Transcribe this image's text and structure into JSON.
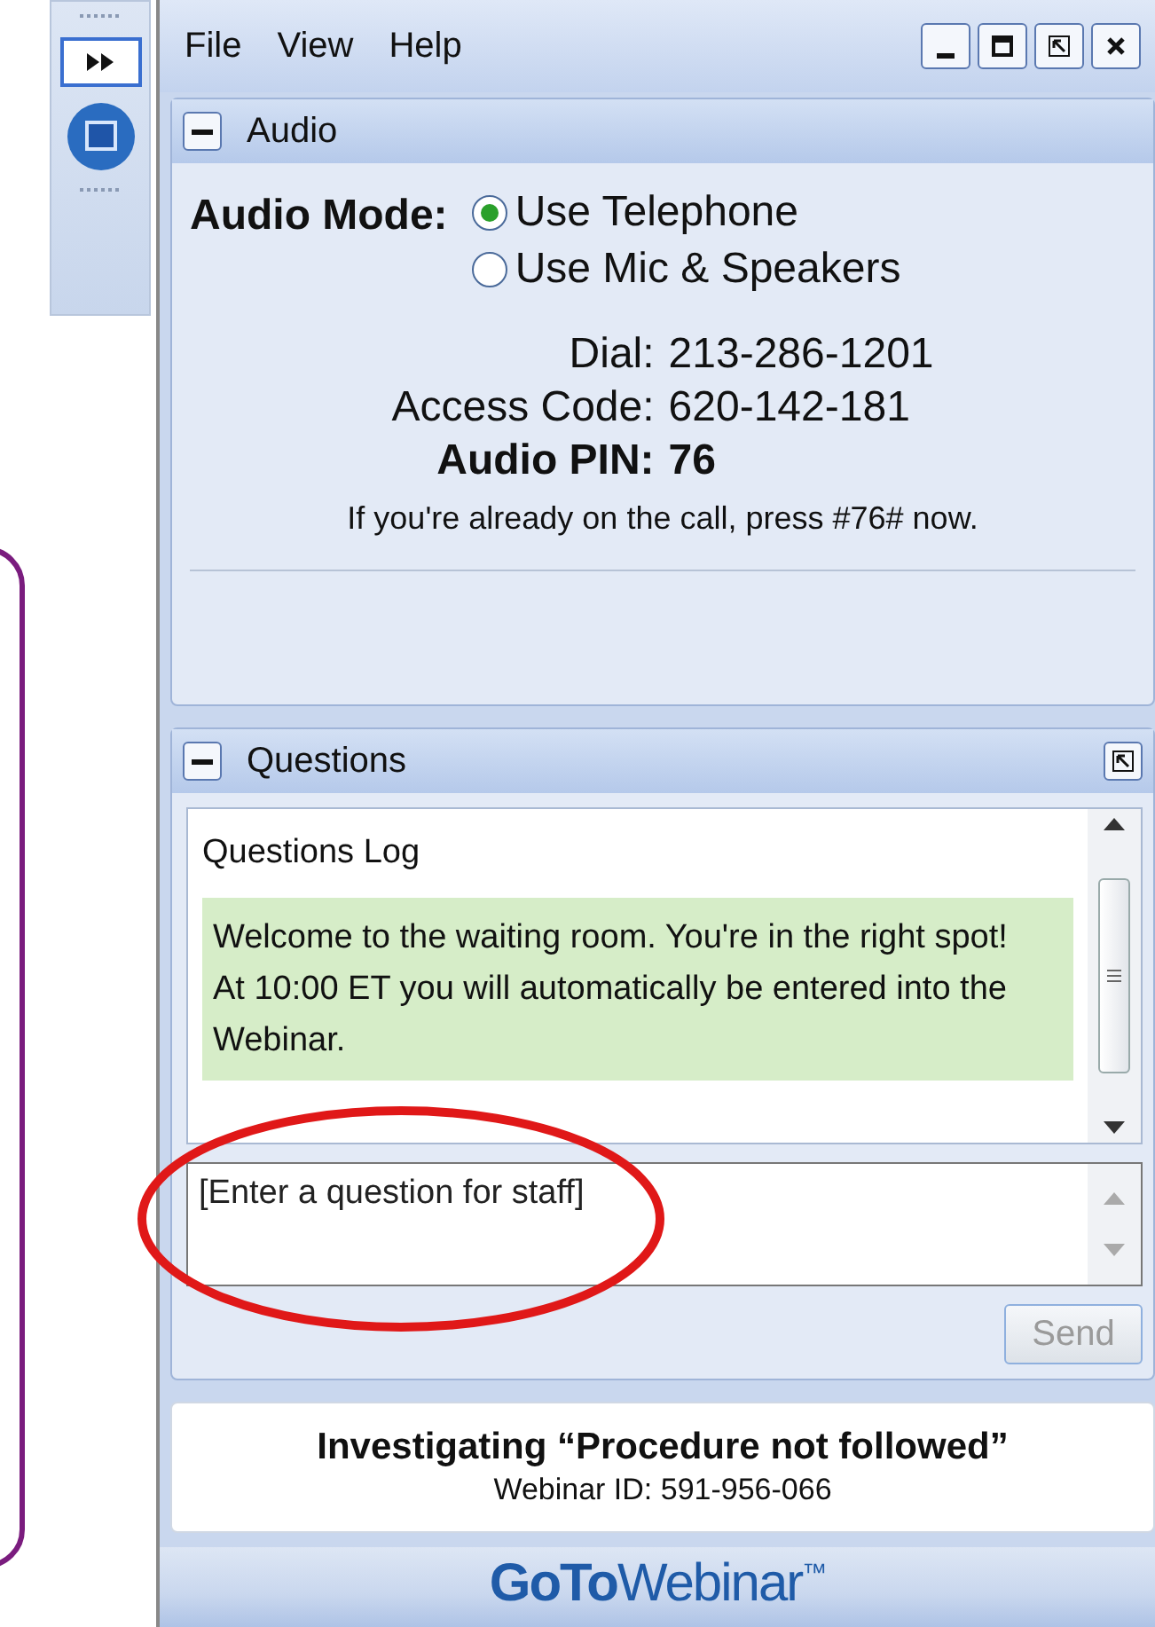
{
  "menu": [
    "File",
    "View",
    "Help"
  ],
  "audio": {
    "title": "Audio",
    "mode_label": "Audio Mode:",
    "options": [
      {
        "label": "Use Telephone",
        "selected": true
      },
      {
        "label": "Use Mic & Speakers",
        "selected": false
      }
    ],
    "details": [
      {
        "kind": "plain",
        "label": "Dial:",
        "value": "213-286-1201"
      },
      {
        "kind": "plain",
        "label": "Access Code:",
        "value": "620-142-181"
      },
      {
        "kind": "strong",
        "label": "Audio PIN:",
        "value": "76"
      }
    ],
    "note": "If you're already on the call, press #76# now."
  },
  "questions": {
    "title": "Questions",
    "log_title": "Questions Log",
    "messages": [
      "Welcome to the waiting room.  You're in the right spot!",
      "At 10:00 ET you will automatically be entered into the Webinar."
    ],
    "placeholder": "[Enter a question for staff]",
    "send": {
      "label": "Send",
      "disabled": true
    }
  },
  "info": {
    "title": "Investigating “Procedure not followed”",
    "webinar_id": "Webinar ID: 591-956-066"
  },
  "logo": {
    "bold": "GoTo",
    "light": "Webinar",
    "mark": "™"
  }
}
